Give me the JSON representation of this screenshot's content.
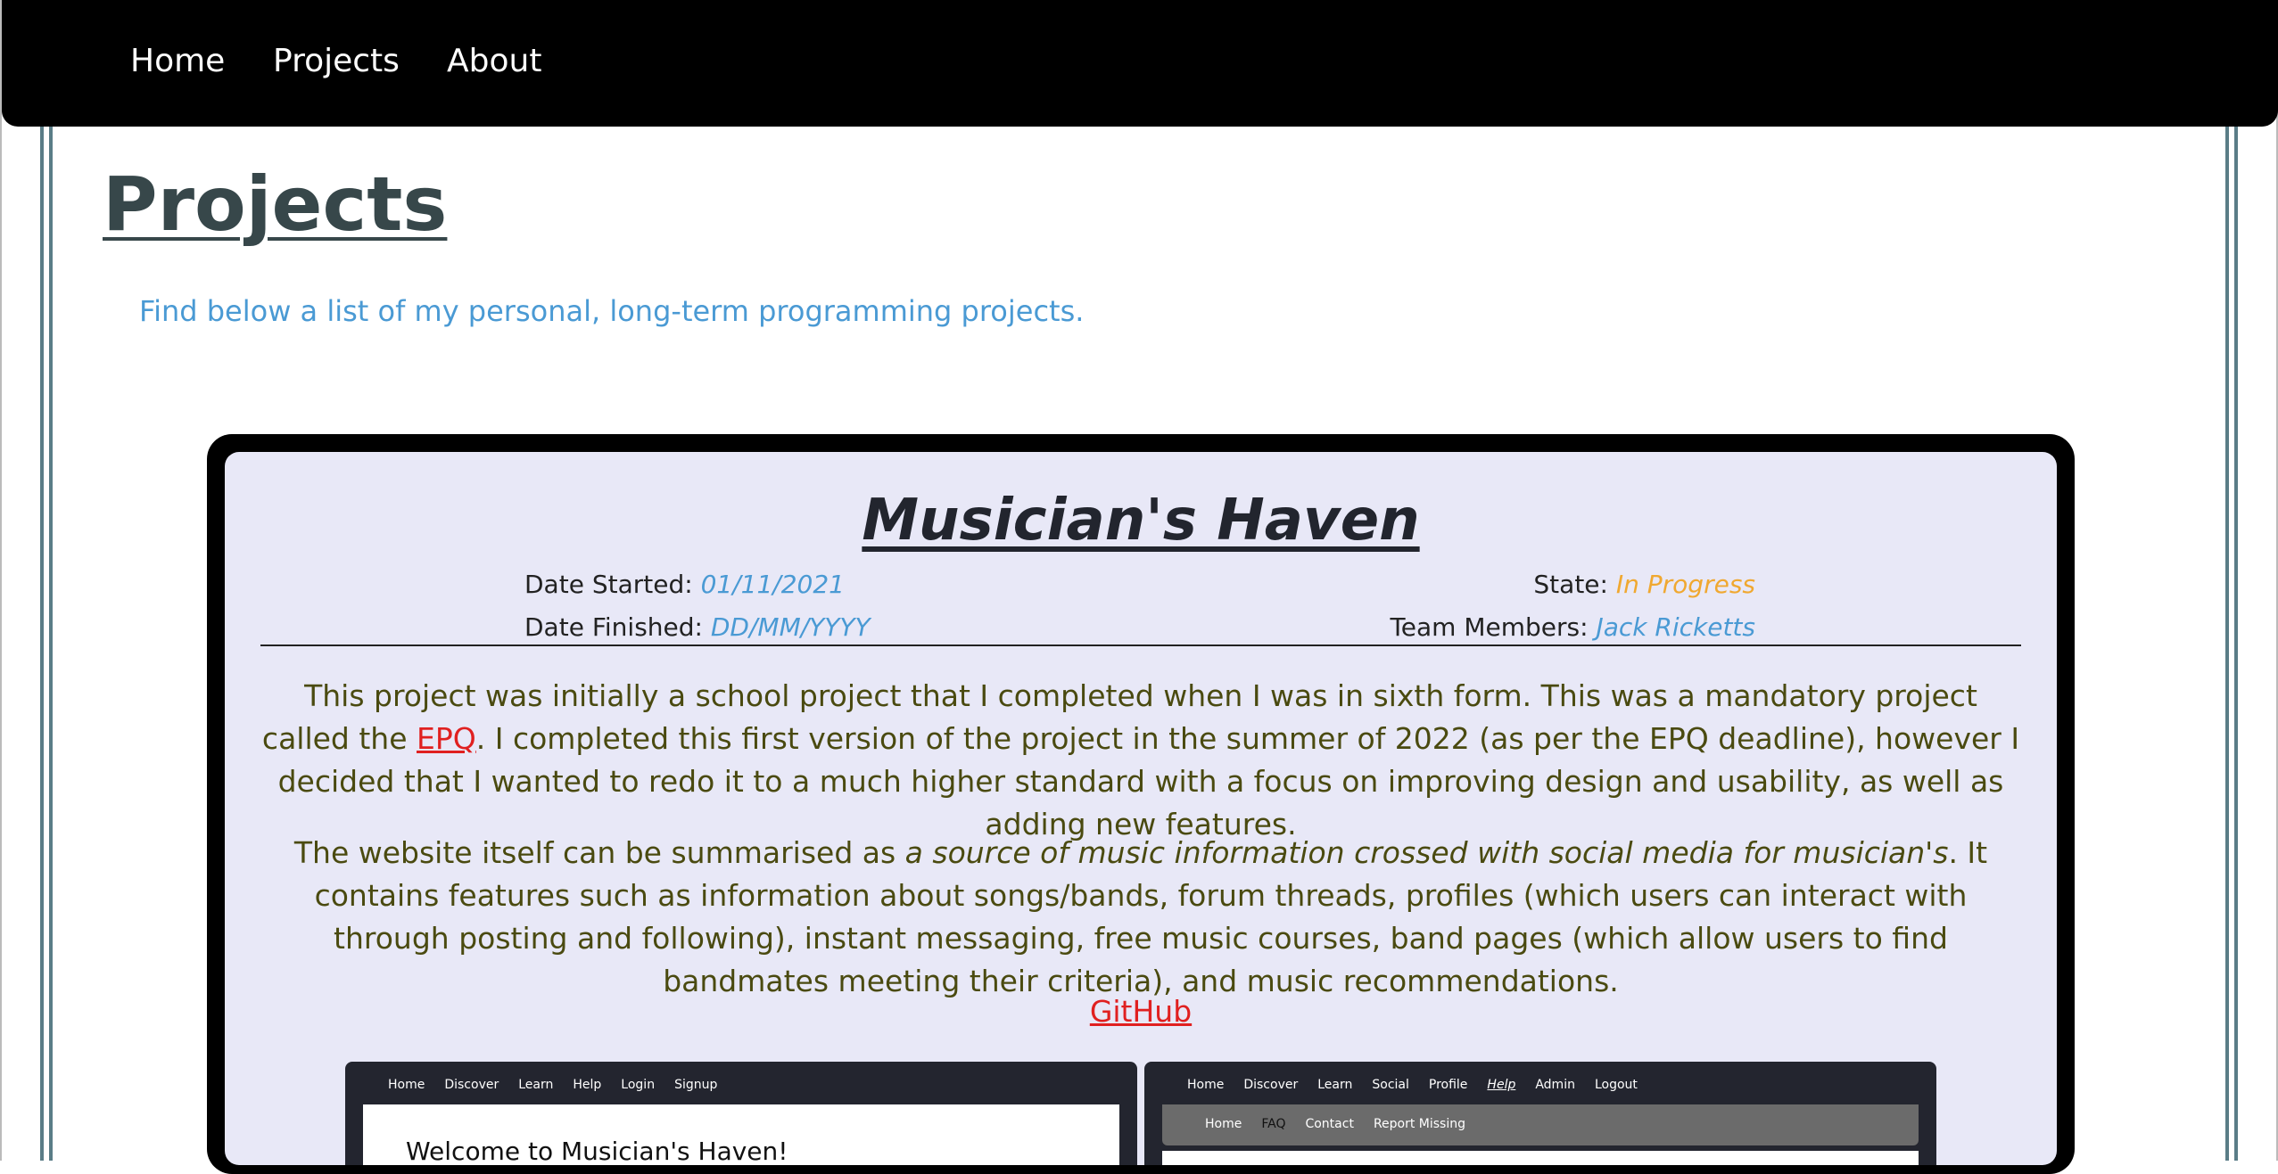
{
  "nav": {
    "items": [
      "Home",
      "Projects",
      "About"
    ]
  },
  "page": {
    "title": "Projects",
    "subtitle": "Find below a list of my personal, long-term programming projects."
  },
  "project": {
    "title": "Musician's Haven",
    "date_started_label": "Date Started:",
    "date_started": "01/11/2021",
    "date_finished_label": "Date Finished:",
    "date_finished": "DD/MM/YYYY",
    "state_label": "State:",
    "state": "In Progress",
    "team_label": "Team Members:",
    "team": "Jack Ricketts",
    "para1_before": "This project was initially a school project that I completed when I was in sixth form. This was a mandatory project called the ",
    "para1_link": "EPQ",
    "para1_after": ". I completed this first version of the project in the summer of 2022 (as per the EPQ deadline), however I decided that I wanted to redo it to a much higher standard with a focus on improving design and usability, as well as adding new features.",
    "para2_before": "The website itself can be summarised as ",
    "para2_em": "a source of music information crossed with social media for musician's",
    "para2_after": ". It contains features such as information about songs/bands, forum threads, profiles (which users can interact with through posting and following), instant messaging, free music courses, band pages (which allow users to find bandmates meeting their criteria), and music recommendations.",
    "github_label": "GitHub"
  },
  "screenshot1": {
    "nav": [
      "Home",
      "Discover",
      "Learn",
      "Help",
      "Login",
      "Signup"
    ],
    "heading": "Welcome to Musician's Haven!"
  },
  "screenshot2": {
    "nav": [
      "Home",
      "Discover",
      "Learn",
      "Social",
      "Profile",
      "Help",
      "Admin",
      "Logout"
    ],
    "subnav": [
      "Home",
      "FAQ",
      "Contact",
      "Report Missing"
    ]
  },
  "colors": {
    "accent_blue": "#4a9ad4",
    "link_red": "#e02020",
    "state_orange": "#f0a830",
    "card_bg": "#e8e8f7",
    "nav_bg": "#000000"
  }
}
